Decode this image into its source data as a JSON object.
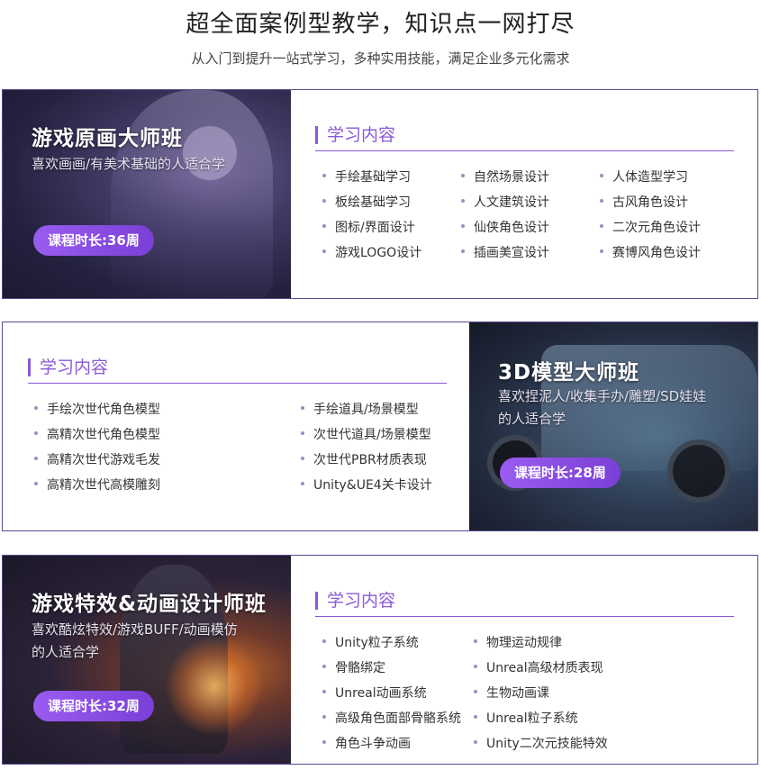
{
  "header": {
    "title": "超全面案例型教学，知识点一网打尽",
    "subtitle": "从入门到提升一站式学习，多种实用技能，满足企业多元化需求"
  },
  "courses": [
    {
      "name": "游戏原画大师班",
      "audience_lines": [
        "喜欢画画/有美术基础的人适合学"
      ],
      "duration": "课程时长:36周",
      "content_title": "学习内容",
      "topics": [
        "手绘基础学习",
        "自然场景设计",
        "人体造型学习",
        "板绘基础学习",
        "人文建筑设计",
        "古风角色设计",
        "图标/界面设计",
        "仙侠角色设计",
        "二次元角色设计",
        "游戏LOGO设计",
        "插画美宣设计",
        "赛博风角色设计"
      ]
    },
    {
      "name": "3D模型大师班",
      "audience_lines": [
        "喜欢捏泥人/收集手办/雕塑/SD娃娃",
        "的人适合学"
      ],
      "duration": "课程时长:28周",
      "content_title": "学习内容",
      "topics": [
        "手绘次世代角色模型",
        "手绘道具/场景模型",
        "高精次世代角色模型",
        "次世代道具/场景模型",
        "高精次世代游戏毛发",
        "次世代PBR材质表现",
        "高精次世代高模雕刻",
        "Unity&UE4关卡设计"
      ]
    },
    {
      "name": "游戏特效&动画设计师班",
      "audience_lines": [
        "喜欢酷炫特效/游戏BUFF/动画模仿",
        "的人适合学"
      ],
      "duration": "课程时长:32周",
      "content_title": "学习内容",
      "topics": [
        "Unity粒子系统",
        "物理运动规律",
        "骨骼绑定",
        "Unreal高级材质表现",
        "Unreal动画系统",
        "生物动画课",
        "高级角色面部骨骼系统",
        "Unreal粒子系统",
        "角色斗争动画",
        "Unity二次元技能特效"
      ]
    }
  ]
}
